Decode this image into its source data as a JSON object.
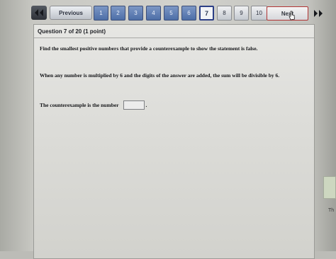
{
  "nav": {
    "previous_label": "Previous",
    "next_label": "Next",
    "pages": [
      "1",
      "2",
      "3",
      "4",
      "5",
      "6",
      "7",
      "8",
      "9",
      "10"
    ],
    "current_page": "7",
    "first_icon": "double-chevron-left-icon",
    "last_icon": "double-chevron-right-icon"
  },
  "question": {
    "header": "Question 7 of 20 (1 point)",
    "prompt": "Find the smallest positive numbers that provide a counterexample to show the statement is false.",
    "statement": "When any number is multiplied by 6 and the digits of the answer are added, the sum will be divisible by 6.",
    "answer_label": "The counterexample is the number",
    "answer_value": "",
    "answer_suffix": "."
  },
  "side": {
    "text": "Th"
  },
  "colors": {
    "next_border": "#b23535",
    "page_active": "#4d6ea7",
    "current_border": "#2c3f86"
  }
}
